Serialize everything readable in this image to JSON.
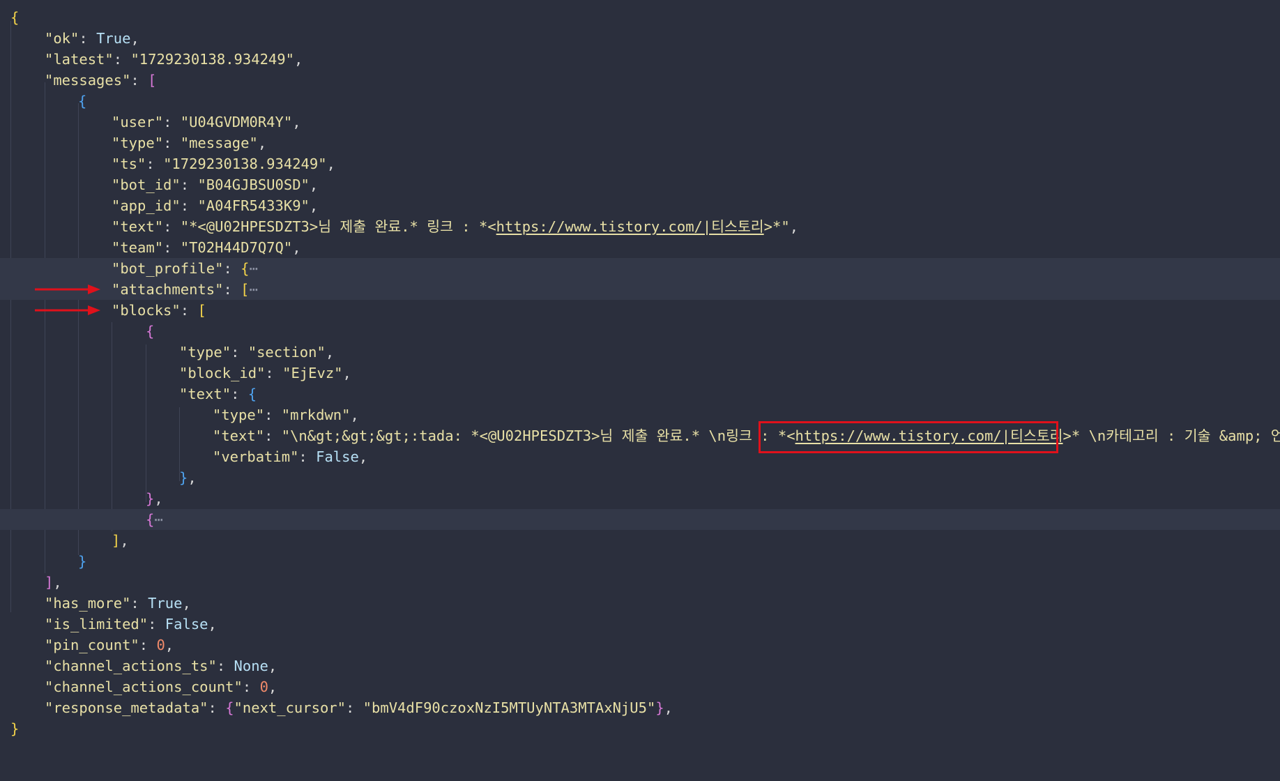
{
  "colors": {
    "background": "#2b2f3d",
    "string": "#e8e0a6",
    "keyword": "#b7e0f5",
    "number": "#f08a6a",
    "brace_yellow": "#f3d34a",
    "bracket_purple": "#d678d6",
    "brace_blue": "#4fa3f0",
    "annotation_red": "#e0111b"
  },
  "json_view": {
    "ok_key": "\"ok\"",
    "ok_val": "True",
    "latest_key": "\"latest\"",
    "latest_val": "\"1729230138.934249\"",
    "messages_key": "\"messages\"",
    "user_key": "\"user\"",
    "user_val": "\"U04GVDM0R4Y\"",
    "type_key": "\"type\"",
    "type_val": "\"message\"",
    "ts_key": "\"ts\"",
    "ts_val": "\"1729230138.934249\"",
    "bot_id_key": "\"bot_id\"",
    "bot_id_val": "\"B04GJBSU0SD\"",
    "app_id_key": "\"app_id\"",
    "app_id_val": "\"A04FR5433K9\"",
    "text_key": "\"text\"",
    "text_val_a": "\"*<@U02HPESDZT3>님 제출 완료.* 링크 : *<",
    "text_val_link": "https://www.tistory.com/|티스토리",
    "text_val_b": ">*\"",
    "team_key": "\"team\"",
    "team_val": "\"T02H44D7Q7Q\"",
    "bot_profile_key": "\"bot_profile\"",
    "attachments_key": "\"attachments\"",
    "blocks_key": "\"blocks\"",
    "block_type_key": "\"type\"",
    "block_type_val": "\"section\"",
    "block_id_key": "\"block_id\"",
    "block_id_val": "\"EjEvz\"",
    "block_text_key": "\"text\"",
    "inner_type_key": "\"type\"",
    "inner_type_val": "\"mrkdwn\"",
    "inner_text_key": "\"text\"",
    "inner_text_a": "\"\\n&gt;&gt;&gt;:tada: *<@U02HPESDZT3>님 제출 완료.* \\n링크 : ",
    "inner_text_b": "*<",
    "inner_text_link": "https://www.tistory.com/|티스토리",
    "inner_text_c": ">*",
    "inner_text_d": " \\n카테고리 : 기술 &amp; 언어\"",
    "verbatim_key": "\"verbatim\"",
    "verbatim_val": "False",
    "has_more_key": "\"has_more\"",
    "has_more_val": "True",
    "is_limited_key": "\"is_limited\"",
    "is_limited_val": "False",
    "pin_count_key": "\"pin_count\"",
    "pin_count_val": "0",
    "channel_actions_ts_key": "\"channel_actions_ts\"",
    "channel_actions_ts_val": "None",
    "channel_actions_count_key": "\"channel_actions_count\"",
    "channel_actions_count_val": "0",
    "response_metadata_key": "\"response_metadata\"",
    "next_cursor_key": "\"next_cursor\"",
    "next_cursor_val": "\"bmV4dF90czoxNzI5MTUyNTA3MTAxNjU5\"",
    "folded_ellipsis": "⋯"
  }
}
